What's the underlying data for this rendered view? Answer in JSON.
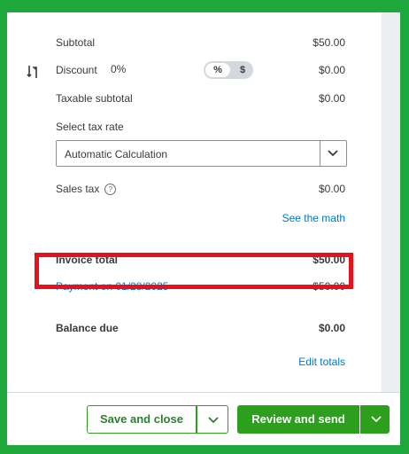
{
  "totals": {
    "subtotal_label": "Subtotal",
    "subtotal_value": "$50.00",
    "discount_label": "Discount",
    "discount_percent": "0%",
    "discount_value": "$0.00",
    "discount_toggle": {
      "percent": "%",
      "dollar": "$",
      "selected": "percent"
    },
    "taxable_subtotal_label": "Taxable subtotal",
    "taxable_subtotal_value": "$0.00",
    "tax_rate_label": "Select tax rate",
    "tax_rate_selected": "Automatic Calculation",
    "sales_tax_label": "Sales tax",
    "sales_tax_help": "?",
    "sales_tax_value": "$0.00",
    "see_math_link": "See the math",
    "invoice_total_label": "Invoice total",
    "invoice_total_value": "$50.00",
    "payment_link": "Payment on 01/28/2025",
    "payment_value": "-$50.00",
    "balance_due_label": "Balance due",
    "balance_due_value": "$0.00",
    "edit_totals_link": "Edit totals"
  },
  "footer": {
    "save_close_label": "Save and close",
    "review_send_label": "Review and send"
  },
  "colors": {
    "frame_border": "#1ea83c",
    "primary_green": "#2ca01c",
    "link_blue": "#0077c5",
    "highlight_red": "#e8101a"
  }
}
